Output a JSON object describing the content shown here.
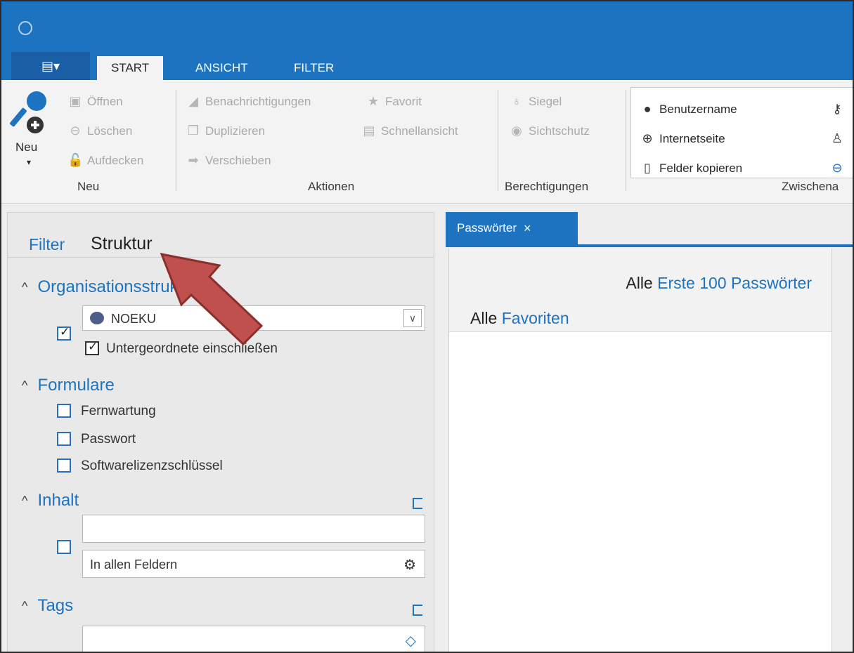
{
  "tabs": {
    "app_menu": "▤▾",
    "start": "START",
    "ansicht": "ANSICHT",
    "filter": "FILTER"
  },
  "ribbon": {
    "neu": {
      "label": "Neu",
      "caret": "▾",
      "oeffnen": "Öffnen",
      "loeschen": "Löschen",
      "aufdecken": "Aufdecken",
      "group": "Neu"
    },
    "aktionen": {
      "benachrichtigungen": "Benachrichtigungen",
      "favorit": "Favorit",
      "duplizieren": "Duplizieren",
      "schnellansicht": "Schnellansicht",
      "verschieben": "Verschieben",
      "group": "Aktionen"
    },
    "berechtigungen": {
      "siegel": "Siegel",
      "sichtschutz": "Sichtschutz",
      "group": "Berechtigungen"
    },
    "zwischenablage": {
      "benutzername": "Benutzername",
      "internetseite": "Internetseite",
      "felder_kopieren": "Felder kopieren",
      "group": "Zwischena"
    }
  },
  "filter_panel": {
    "tab_filter": "Filter",
    "tab_struktur": "Struktur",
    "org": {
      "title": "Organisationsstruktur",
      "value": "NOEKU",
      "include_sub": "Untergeordnete einschließen"
    },
    "formulare": {
      "title": "Formulare",
      "items": [
        "Fernwartung",
        "Passwort",
        "Softwarelizenzschlüssel"
      ]
    },
    "inhalt": {
      "title": "Inhalt",
      "scope": "In allen Feldern"
    },
    "tags": {
      "title": "Tags"
    }
  },
  "document": {
    "tab_label": "Passwörter",
    "alle1": "Alle",
    "erste100": "Erste 100 Passwörter",
    "alle2": "Alle",
    "favoriten": "Favoriten"
  },
  "colors": {
    "accent": "#1e73c0",
    "annotation": "#c0504d"
  }
}
